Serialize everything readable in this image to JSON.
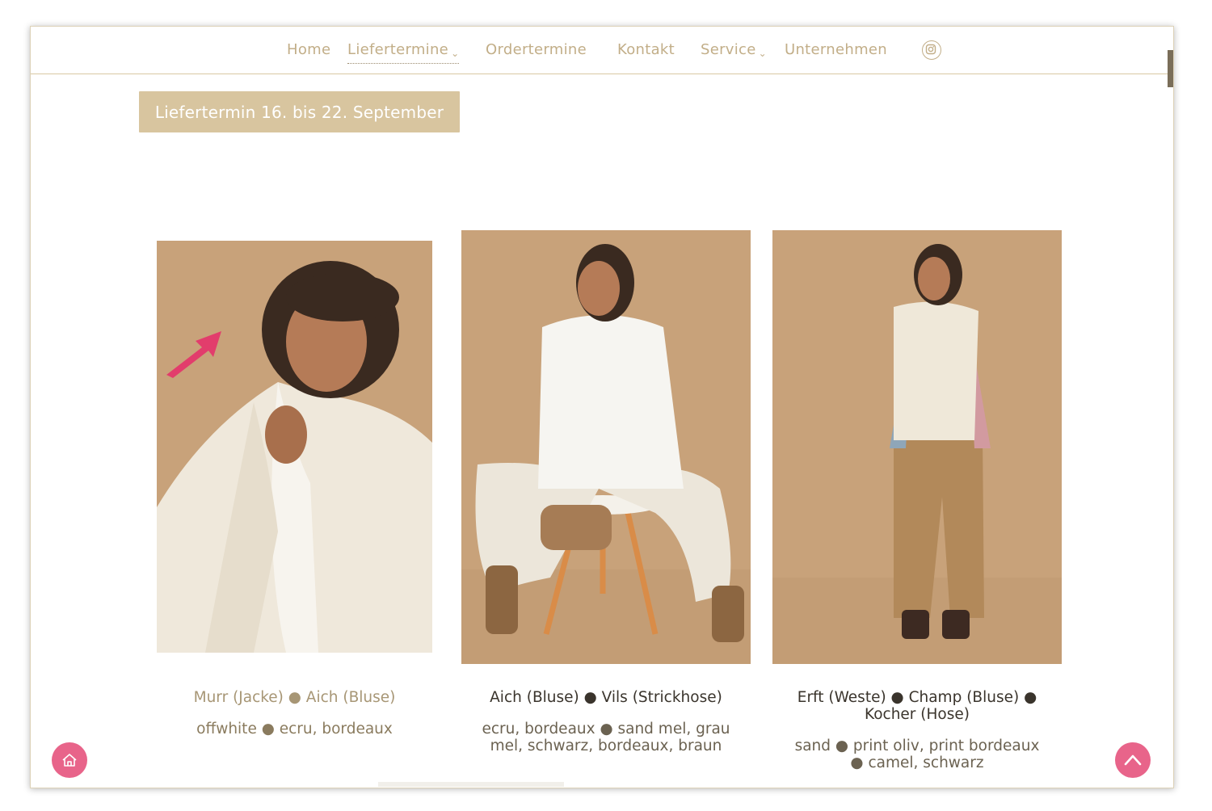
{
  "nav": {
    "items": [
      {
        "label": "Home"
      },
      {
        "label": "Liefertermine"
      },
      {
        "label": "Ordertermine"
      },
      {
        "label": "Kontakt"
      },
      {
        "label": "Service"
      },
      {
        "label": "Unternehmen"
      }
    ],
    "active": "Liefertermine",
    "dropdown_marker": "⌄",
    "icons": [
      "instagram-icon"
    ]
  },
  "delivery_button": {
    "label": "Liefertermin 16. bis 22. September"
  },
  "products": [
    {
      "names": "Murr (Jacke) ● Aich (Bluse)",
      "colors": "offwhite ● ecru, bordeaux"
    },
    {
      "names": "Aich (Bluse) ● Vils (Strickhose)",
      "colors": "ecru, bordeaux ● sand mel, grau mel, schwarz, bordeaux, braun"
    },
    {
      "names": "Erft (Weste) ● Champ (Bluse) ● Kocher (Hose)",
      "colors": "sand ● print oliv, print bordeaux ● camel, schwarz"
    }
  ],
  "fabs": {
    "home_icon": "house-icon",
    "top_icon": "chevron-up-icon"
  },
  "colors": {
    "accent": "#d8c59f",
    "nav_text": "#c2ae88",
    "photo_bg": "#c8a27a",
    "fab": "#e8648a",
    "arrow": "#e23d6c"
  }
}
